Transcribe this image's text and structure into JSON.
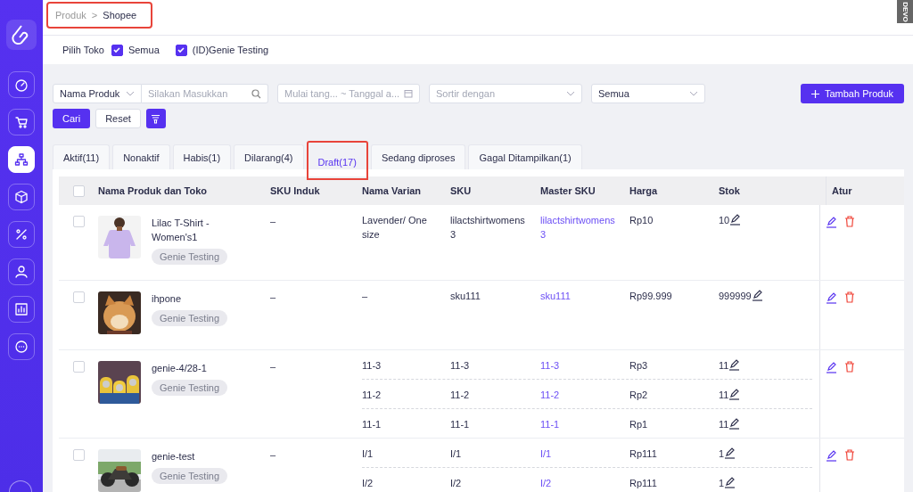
{
  "sidebar": {
    "items": [
      {
        "kind": "gauge",
        "selected": false
      },
      {
        "kind": "cart",
        "selected": false
      },
      {
        "kind": "hierarchy",
        "selected": true
      },
      {
        "kind": "cube",
        "selected": false
      },
      {
        "kind": "percent",
        "selected": false
      },
      {
        "kind": "user",
        "selected": false
      },
      {
        "kind": "chart",
        "selected": false
      },
      {
        "kind": "chat",
        "selected": false
      }
    ]
  },
  "breadcrumb": {
    "items": [
      "Produk",
      "Shopee"
    ],
    "separator": ">",
    "highlighted": true
  },
  "devtools_tab": "DEVO",
  "store_filter": {
    "label": "Pilih Toko",
    "options": [
      {
        "label": "Semua",
        "checked": true
      },
      {
        "label": "(ID)Genie Testing",
        "checked": true
      }
    ]
  },
  "filters": {
    "field_select": "Nama Produk",
    "search_placeholder": "Silakan Masukkan",
    "date_start_placeholder": "Mulai tang...",
    "date_separator": "~",
    "date_end_placeholder": "Tanggal a...",
    "sort_placeholder": "Sortir dengan",
    "status_select": "Semua"
  },
  "buttons": {
    "search": "Cari",
    "reset": "Reset",
    "add_product": "Tambah Produk"
  },
  "tabs": [
    {
      "label": "Aktif(11)",
      "selected": false,
      "highlighted": false
    },
    {
      "label": "Nonaktif",
      "selected": false,
      "highlighted": false
    },
    {
      "label": "Habis(1)",
      "selected": false,
      "highlighted": false
    },
    {
      "label": "Dilarang(4)",
      "selected": false,
      "highlighted": false
    },
    {
      "label": "Draft(17)",
      "selected": true,
      "highlighted": true
    },
    {
      "label": "Sedang diproses",
      "selected": false,
      "highlighted": false
    },
    {
      "label": "Gagal Ditampilkan(1)",
      "selected": false,
      "highlighted": false
    }
  ],
  "table": {
    "all_checked": false,
    "columns": [
      "Nama Produk dan Toko",
      "SKU Induk",
      "Nama Varian",
      "SKU",
      "Master SKU",
      "Harga",
      "Stok",
      "Atur"
    ],
    "rows": [
      {
        "checked": false,
        "picture": {
          "kind": "picture"
        },
        "name": "Lilac T-Shirt - Women's1",
        "store": "Genie Testing",
        "sku_parent": "–",
        "variants": [
          {
            "name": "Lavender/ One size",
            "sku": "lilactshirtwomens3",
            "master_sku": "lilactshirtwomens3",
            "price": "Rp10",
            "stock": "10"
          }
        ]
      },
      {
        "checked": false,
        "picture": {
          "kind": "picture"
        },
        "name": "ihpone",
        "store": "Genie Testing",
        "sku_parent": "–",
        "variants": [
          {
            "name": "–",
            "sku": "sku111",
            "master_sku": "sku111",
            "price": "Rp99.999",
            "stock": "999999"
          }
        ]
      },
      {
        "checked": false,
        "picture": {
          "kind": "picture"
        },
        "name": "genie-4/28-1",
        "store": "Genie Testing",
        "sku_parent": "–",
        "variants": [
          {
            "name": "11-3",
            "sku": "11-3",
            "master_sku": "11-3",
            "price": "Rp3",
            "stock": "11"
          },
          {
            "name": "11-2",
            "sku": "11-2",
            "master_sku": "11-2",
            "price": "Rp2",
            "stock": "11"
          },
          {
            "name": "11-1",
            "sku": "11-1",
            "master_sku": "11-1",
            "price": "Rp1",
            "stock": "11"
          }
        ]
      },
      {
        "checked": false,
        "picture": {
          "kind": "picture"
        },
        "name": "genie-test",
        "store": "Genie Testing",
        "sku_parent": "–",
        "variants": [
          {
            "name": "I/1",
            "sku": "I/1",
            "master_sku": "I/1",
            "price": "Rp111",
            "stock": "1"
          },
          {
            "name": "I/2",
            "sku": "I/2",
            "master_sku": "I/2",
            "price": "Rp111",
            "stock": "1"
          }
        ]
      }
    ]
  }
}
